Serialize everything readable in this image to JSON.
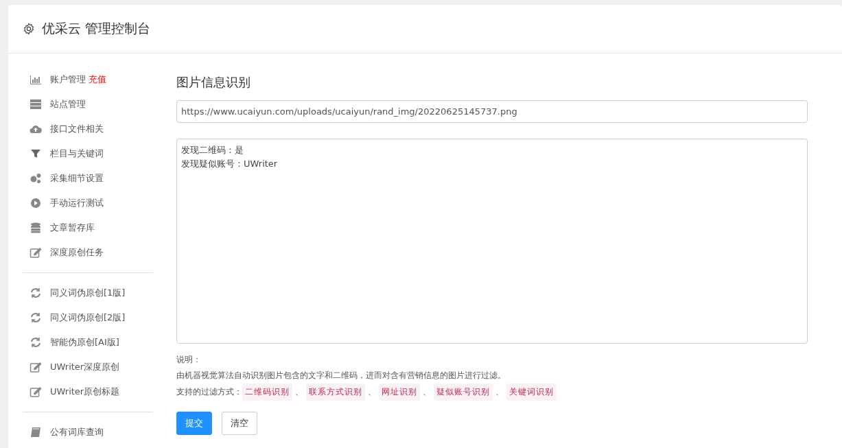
{
  "header": {
    "title": "优采云 管理控制台"
  },
  "sidebar": {
    "groups": [
      [
        {
          "label": "账户管理",
          "badge": "充值"
        },
        {
          "label": "站点管理"
        },
        {
          "label": "接口文件相关"
        },
        {
          "label": "栏目与关键词"
        },
        {
          "label": "采集细节设置"
        },
        {
          "label": "手动运行测试"
        },
        {
          "label": "文章暂存库"
        },
        {
          "label": "深度原创任务"
        }
      ],
      [
        {
          "label": "同义词伪原创[1版]"
        },
        {
          "label": "同义词伪原创[2版]"
        },
        {
          "label": "智能伪原创[AI版]"
        },
        {
          "label": "UWriter深度原创"
        },
        {
          "label": "UWriter原创标题"
        }
      ],
      [
        {
          "label": "公有词库查询"
        }
      ]
    ]
  },
  "main": {
    "title": "图片信息识别",
    "url_field": {
      "value": "https://www.ucaiyun.com/uploads/ucaiyun/rand_img/20220625145737.png"
    },
    "result_box": {
      "lines": [
        "发现二维码：是",
        "发现疑似账号：UWriter"
      ]
    },
    "notes": {
      "heading": "说明：",
      "description": "由机器视觉算法自动识别图片包含的文字和二维码，进而对含有营销信息的图片进行过滤。",
      "methods_label": "支持的过滤方式：",
      "methods": [
        "二维码识别",
        "联系方式识别",
        "网址识别",
        "疑似账号识别",
        "关键词识别"
      ],
      "separator": "、"
    },
    "buttons": [
      {
        "label": "提交",
        "kind": "primary"
      },
      {
        "label": "清空",
        "kind": "default"
      }
    ]
  }
}
